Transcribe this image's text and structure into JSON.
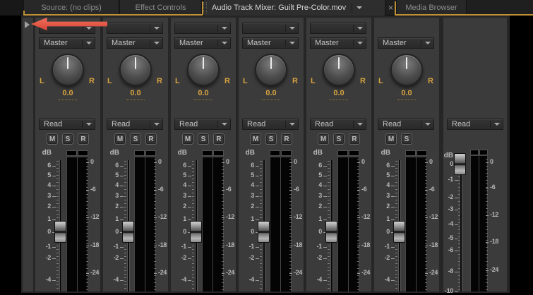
{
  "tab_bar": {
    "tabs": [
      {
        "id": "source",
        "label": "Source: (no clips)",
        "active": false
      },
      {
        "id": "effect-controls",
        "label": "Effect Controls",
        "active": false
      },
      {
        "id": "audio-track-mixer",
        "label": "Audio Track Mixer: Guilt Pre-Color.mov",
        "active": true,
        "has_panel_menu": true,
        "close_label": "×"
      },
      {
        "id": "media-browser",
        "label": "Media Browser",
        "active": false
      }
    ]
  },
  "left_rail": {
    "expand_button": "show-effects-and-sends"
  },
  "channel_strips": [
    {
      "has_effects_slot": true,
      "effects_slot": "",
      "output_assign": "Master",
      "pan": {
        "left": "L",
        "right": "R",
        "value": "0.0"
      },
      "automation_mode": "Read",
      "mute": "M",
      "solo": "S",
      "record": "R"
    },
    {
      "has_effects_slot": true,
      "effects_slot": "",
      "output_assign": "Master",
      "pan": {
        "left": "L",
        "right": "R",
        "value": "0.0"
      },
      "automation_mode": "Read",
      "mute": "M",
      "solo": "S",
      "record": "R"
    },
    {
      "has_effects_slot": true,
      "effects_slot": "",
      "output_assign": "Master",
      "pan": {
        "left": "L",
        "right": "R",
        "value": "0.0"
      },
      "automation_mode": "Read",
      "mute": "M",
      "solo": "S",
      "record": "R"
    },
    {
      "has_effects_slot": true,
      "effects_slot": "",
      "output_assign": "Master",
      "pan": {
        "left": "L",
        "right": "R",
        "value": "0.0"
      },
      "automation_mode": "Read",
      "mute": "M",
      "solo": "S",
      "record": "R"
    },
    {
      "has_effects_slot": true,
      "effects_slot": "",
      "output_assign": "Master",
      "pan": {
        "left": "L",
        "right": "R",
        "value": "0.0"
      },
      "automation_mode": "Read",
      "mute": "M",
      "solo": "S",
      "record": "R"
    },
    {
      "output_assign": "Master",
      "pan": {
        "left": "L",
        "right": "R",
        "value": "0.0"
      },
      "automation_mode": "Read",
      "mute": "M",
      "solo": "S"
    }
  ],
  "channel_fader": {
    "unit_label": "dB",
    "scale_labels": [
      "6",
      "5",
      "4",
      "3",
      "2",
      "1",
      "0",
      "-1",
      "-2",
      "-4"
    ],
    "handle_position_db": "0"
  },
  "channel_meter": {
    "scale_labels": [
      "0",
      "-6",
      "-12",
      "-18",
      "-24"
    ]
  },
  "master_strip": {
    "automation_mode": "Read",
    "unit_label": "dB",
    "fader_scale_labels": [
      "0",
      "-1",
      "-2",
      "-3",
      "-4",
      "-5",
      "-6",
      "-8",
      "-10"
    ],
    "meter_scale_labels": [
      "0",
      "-6",
      "-12",
      "-18",
      "-24"
    ],
    "handle_position_db": "0"
  },
  "annotation": {
    "type": "arrow",
    "direction": "left",
    "color": "#e0503f"
  },
  "colors": {
    "focus_gold": "#c09134",
    "value_gold": "#d7a43e",
    "strip_bg": "#3b3b3b",
    "panel_bg": "#262626"
  }
}
